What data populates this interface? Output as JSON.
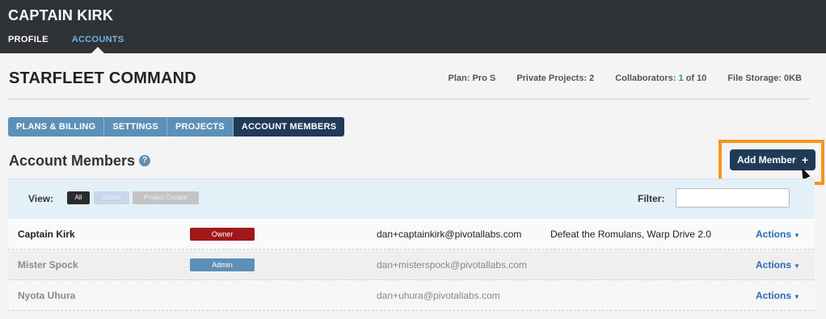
{
  "header": {
    "user_name": "CAPTAIN KIRK",
    "nav": [
      {
        "label": "PROFILE",
        "active": false
      },
      {
        "label": "ACCOUNTS",
        "active": true
      }
    ]
  },
  "account": {
    "title": "STARFLEET COMMAND",
    "plan": "Plan: Pro S",
    "private_projects": "Private Projects: 2",
    "collaborators_label": "Collaborators:",
    "collaborators_count": "1",
    "collaborators_total": "of 10",
    "file_storage": "File Storage: 0KB"
  },
  "tabs": [
    {
      "label": "PLANS & BILLING",
      "active": false
    },
    {
      "label": "SETTINGS",
      "active": false
    },
    {
      "label": "PROJECTS",
      "active": false
    },
    {
      "label": "ACCOUNT MEMBERS",
      "active": true
    }
  ],
  "section": {
    "title": "Account Members",
    "help_icon": "?",
    "add_button": "Add Member",
    "add_icon": "+"
  },
  "filter": {
    "view_label": "View:",
    "view_options": [
      "All",
      "Admin",
      "Project Creator"
    ],
    "selected_view": "All",
    "filter_label": "Filter:",
    "filter_value": ""
  },
  "members": [
    {
      "name": "Captain Kirk",
      "role": "Owner",
      "email": "dan+captainkirk@pivotallabs.com",
      "projects": "Defeat the Romulans, Warp Drive 2.0",
      "actions": "Actions"
    },
    {
      "name": "Mister Spock",
      "role": "Admin",
      "email": "dan+misterspock@pivotallabs.com",
      "projects": "",
      "actions": "Actions"
    },
    {
      "name": "Nyota Uhura",
      "role": "",
      "email": "dan+uhura@pivotallabs.com",
      "projects": "",
      "actions": "Actions"
    }
  ],
  "colors": {
    "header_bg": "#2f3336",
    "accent_blue": "#5d90b8",
    "active_tab": "#1f3b58",
    "owner_badge": "#a01818",
    "highlight_orange": "#f7941d",
    "link_blue": "#2a6ab3"
  }
}
